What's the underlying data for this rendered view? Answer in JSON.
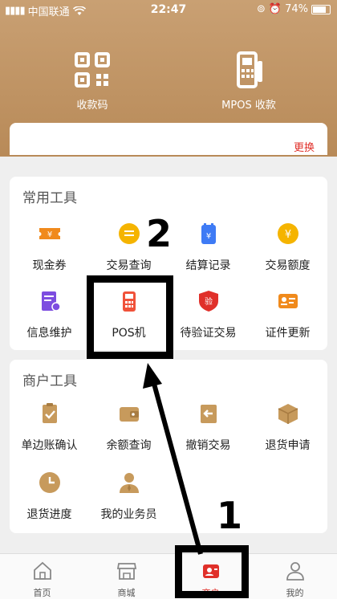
{
  "status_bar": {
    "carrier": "中国联通",
    "time": "22:47",
    "battery": "74%"
  },
  "top_actions": [
    {
      "label": "收款码",
      "icon": "qr-code-icon"
    },
    {
      "label": "MPOS 收款",
      "icon": "pos-terminal-icon"
    }
  ],
  "card": {
    "change_label": "更换"
  },
  "common_tools": {
    "title": "常用工具",
    "items": [
      {
        "label": "现金券",
        "icon": "coupon-icon",
        "color": "#f08a1c"
      },
      {
        "label": "交易查询",
        "icon": "transaction-query-icon",
        "color": "#f5b400"
      },
      {
        "label": "结算记录",
        "icon": "settlement-record-icon",
        "color": "#3e7bf5"
      },
      {
        "label": "交易额度",
        "icon": "transaction-limit-icon",
        "color": "#f5b400"
      },
      {
        "label": "信息维护",
        "icon": "info-maintenance-icon",
        "color": "#7d4de0"
      },
      {
        "label": "POS机",
        "icon": "pos-machine-icon",
        "color": "#f0523a"
      },
      {
        "label": "待验证交易",
        "icon": "pending-verify-icon",
        "color": "#e0302a",
        "badge": "验"
      },
      {
        "label": "证件更新",
        "icon": "id-update-icon",
        "color": "#f08a1c"
      }
    ]
  },
  "merchant_tools": {
    "title": "商户工具",
    "items": [
      {
        "label": "单边账确认",
        "icon": "clipboard-check-icon"
      },
      {
        "label": "余额查询",
        "icon": "wallet-icon"
      },
      {
        "label": "撤销交易",
        "icon": "revoke-icon"
      },
      {
        "label": "退货申请",
        "icon": "box-icon"
      },
      {
        "label": "退货进度",
        "icon": "clock-icon"
      },
      {
        "label": "我的业务员",
        "icon": "salesperson-icon"
      }
    ]
  },
  "tabbar": [
    {
      "label": "首页",
      "icon": "home-icon"
    },
    {
      "label": "商城",
      "icon": "store-icon"
    },
    {
      "label": "商户",
      "icon": "merchant-icon",
      "active": true
    },
    {
      "label": "我的",
      "icon": "person-icon"
    }
  ],
  "annotations": {
    "step1": "1",
    "step2": "2"
  },
  "colors": {
    "brand_gold": "#c9a073",
    "accent_red": "#e0302a",
    "merchant_brown": "#c79a5c"
  }
}
